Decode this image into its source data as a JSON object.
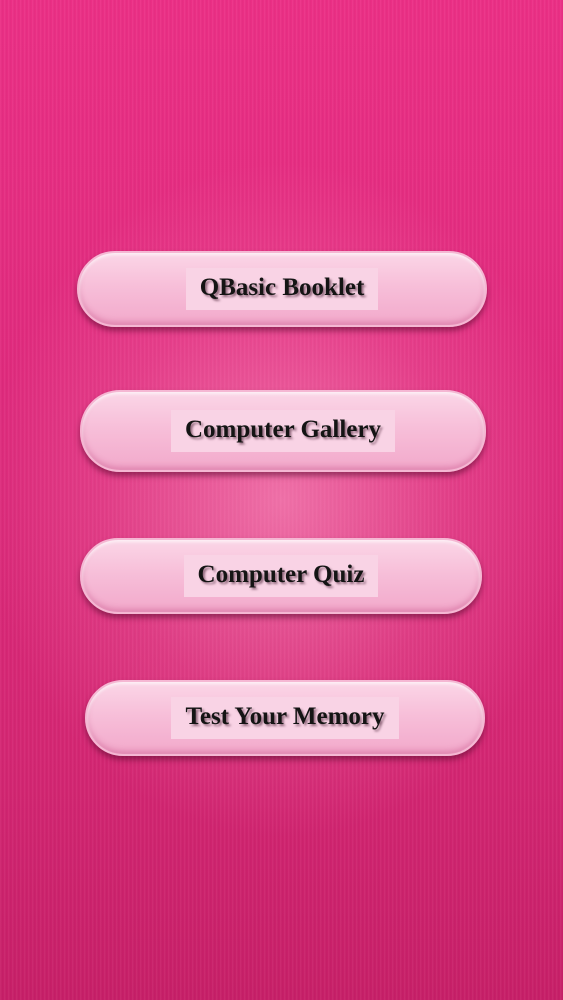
{
  "menu": {
    "items": [
      {
        "label": "QBasic Booklet"
      },
      {
        "label": "Computer Gallery"
      },
      {
        "label": "Computer Quiz"
      },
      {
        "label": "Test Your Memory"
      }
    ]
  },
  "colors": {
    "background": "#e02a7d",
    "button_face": "#f7bfd9",
    "label_text": "#141414"
  }
}
